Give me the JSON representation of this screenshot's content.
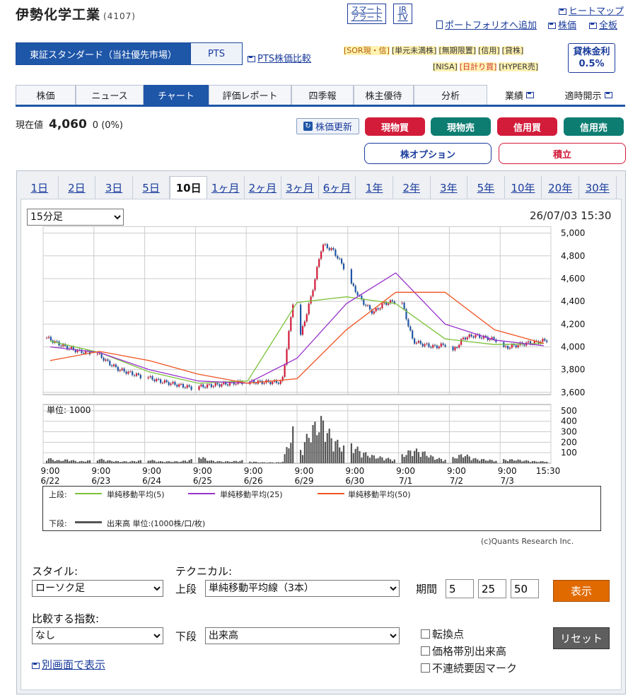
{
  "stock": {
    "name": "伊勢化学工業",
    "code": "(4107)"
  },
  "header_links": {
    "smart_alert": "スマート\nアラート",
    "ir_tv": "IR\nTV",
    "heatmap": "ヒートマップ",
    "portfolio": "ポートフォリオへ追加",
    "stock_price": "株価",
    "all_board": "全板",
    "pts_compare": "PTS株価比較"
  },
  "tags_row1": [
    "[SOR現・信]",
    "[単元未満株]",
    "[無期限置]",
    "[信用]",
    "[貸株]"
  ],
  "tags_row2": [
    "[NISA]",
    "[日計り買]",
    "[HYPER売]"
  ],
  "lending": {
    "label": "貸株金利",
    "value": "0.5%"
  },
  "market": {
    "primary": "東証スタンダード（当社優先市場）",
    "pts": "PTS"
  },
  "tabs": [
    "株価",
    "ニュース",
    "チャート",
    "評価レポート",
    "四季報",
    "株主優待",
    "分析"
  ],
  "tabs_right": [
    "業績",
    "適時開示"
  ],
  "price": {
    "label": "現在値",
    "value": "4,060",
    "change": "0 (0%)"
  },
  "actions": {
    "refresh": "株価更新",
    "cash_buy": "現物買",
    "cash_sell": "現物売",
    "margin_buy": "信用買",
    "margin_sell": "信用売",
    "option": "株オプション",
    "accumulate": "積立"
  },
  "periods": [
    "1日",
    "2日",
    "3日",
    "5日",
    "10日",
    "1ヶ月",
    "2ヶ月",
    "3ヶ月",
    "6ヶ月",
    "1年",
    "2年",
    "3年",
    "5年",
    "10年",
    "20年",
    "30年"
  ],
  "active_period": "10日",
  "interval_select": "15分足",
  "timestamp": "26/07/03 15:30",
  "chart_data": {
    "type": "line",
    "description_free": true,
    "price_axis": {
      "ticks": [
        3600,
        3800,
        4000,
        4200,
        4400,
        4600,
        4800,
        5000
      ],
      "ylim": [
        3580,
        5060
      ]
    },
    "volume_axis": {
      "label": "単位: 1000",
      "ticks": [
        100,
        200,
        300,
        400,
        500
      ],
      "ylim": [
        0,
        560
      ]
    },
    "x_tick_labels": [
      {
        "time": "9:00",
        "date": "6/22"
      },
      {
        "time": "9:00",
        "date": "6/23"
      },
      {
        "time": "9:00",
        "date": "6/24"
      },
      {
        "time": "9:00",
        "date": "6/25"
      },
      {
        "time": "9:00",
        "date": "6/26"
      },
      {
        "time": "9:00",
        "date": "6/29"
      },
      {
        "time": "9:00",
        "date": "6/30"
      },
      {
        "time": "9:00",
        "date": "7/1"
      },
      {
        "time": "9:00",
        "date": "7/2"
      },
      {
        "time": "9:00",
        "date": "7/3"
      },
      {
        "time": "15:30",
        "date": ""
      }
    ],
    "close_by_session": [
      [
        4080,
        4030,
        3990,
        3960,
        3950
      ],
      [
        3940,
        3860,
        3800,
        3770,
        3740
      ],
      [
        3730,
        3700,
        3680,
        3660,
        3640
      ],
      [
        3650,
        3660,
        3670,
        3680,
        3690
      ],
      [
        3690,
        3690,
        3690,
        3690,
        4390
      ],
      [
        4100,
        4450,
        4900,
        4850,
        4700
      ],
      [
        4550,
        4400,
        4300,
        4380,
        4400
      ],
      [
        4380,
        4050,
        4020,
        4000,
        4020
      ],
      [
        3960,
        4080,
        4100,
        4080,
        4060
      ],
      [
        3990,
        4010,
        4030,
        4040,
        4060
      ]
    ],
    "series": [
      {
        "name": "単純移動平均(5)",
        "color": "#7cc23a",
        "values": [
          4050,
          3950,
          3780,
          3680,
          3700,
          4390,
          4440,
          4380,
          4070,
          4020,
          4030
        ]
      },
      {
        "name": "単純移動平均(25)",
        "color": "#9933cc",
        "values": [
          4000,
          3950,
          3800,
          3700,
          3680,
          3900,
          4380,
          4650,
          4200,
          4060,
          4010
        ]
      },
      {
        "name": "単純移動平均(50)",
        "color": "#ee5522",
        "values": [
          3880,
          3960,
          3880,
          3760,
          3680,
          3720,
          4150,
          4480,
          4480,
          4150,
          4030
        ]
      }
    ],
    "volume_by_session": [
      [
        60,
        30,
        40,
        20,
        30
      ],
      [
        50,
        30,
        20,
        20,
        30
      ],
      [
        40,
        20,
        20,
        20,
        40
      ],
      [
        80,
        30,
        20,
        20,
        30
      ],
      [
        20,
        10,
        10,
        10,
        360
      ],
      [
        150,
        380,
        470,
        260,
        180
      ],
      [
        210,
        120,
        80,
        60,
        40
      ],
      [
        90,
        150,
        120,
        60,
        40
      ],
      [
        60,
        100,
        50,
        40,
        30
      ],
      [
        40,
        40,
        30,
        20,
        20
      ]
    ],
    "legend_upper_label": "上段:",
    "legend_lower_label": "下段:",
    "legend_volume": "出来高 単位:(1000株/口/枚)",
    "copyright": "(c)Quants Research Inc."
  },
  "form": {
    "style_label": "スタイル:",
    "style_value": "ローソク足",
    "technical_label": "テクニカル:",
    "upper_label": "上段",
    "upper_value": "単純移動平均線（3本）",
    "period_label": "期間",
    "periods": [
      "5",
      "25",
      "50"
    ],
    "show_button": "表示",
    "compare_label": "比較する指数:",
    "compare_value": "なし",
    "lower_label": "下段",
    "lower_value": "出来高",
    "checks": [
      "転換点",
      "価格帯別出来高",
      "不連続要因マーク"
    ],
    "reset_button": "リセット",
    "separate_window": "別画面で表示"
  }
}
